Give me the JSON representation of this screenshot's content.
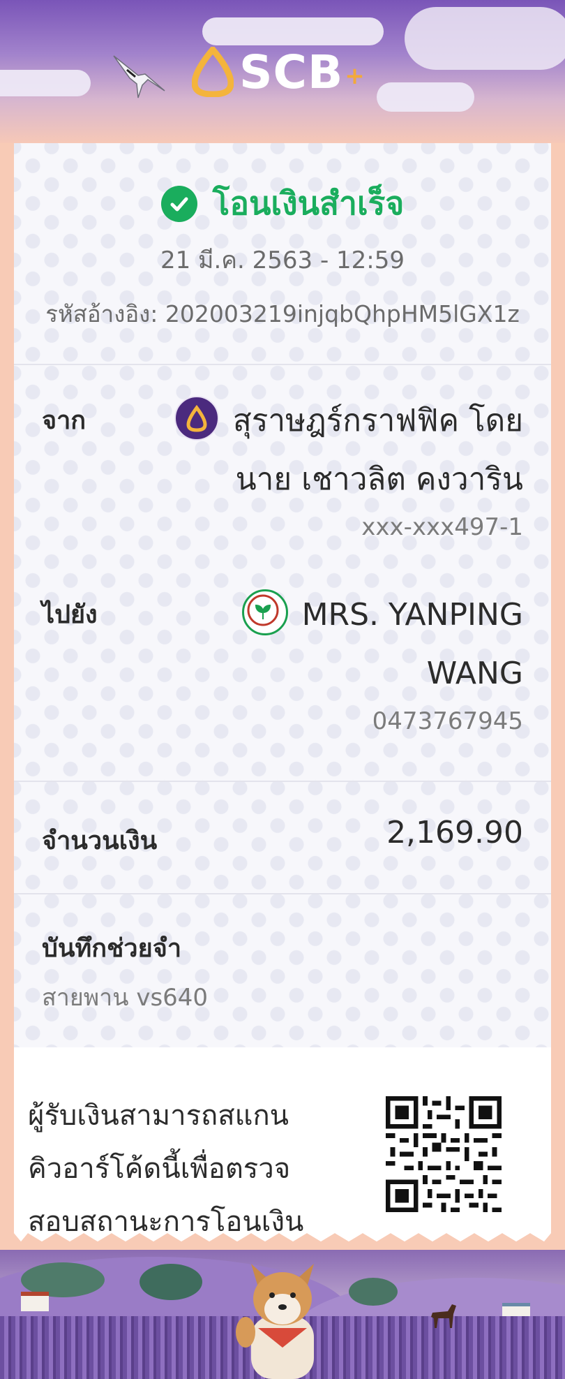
{
  "brand": {
    "name": "SCB",
    "plus": "+"
  },
  "colors": {
    "success": "#1aad5d",
    "brand_purple": "#4b2a7e",
    "brand_gold": "#f2a93b",
    "kbank_green": "#1aa04f"
  },
  "status": {
    "icon": "check-circle-icon",
    "text": "โอนเงินสำเร็จ"
  },
  "transaction": {
    "datetime": "21 มี.ค. 2563 - 12:59",
    "reference_label": "รหัสอ้างอิง:",
    "reference_value": "202003219injqbQhpHM5lGX1z"
  },
  "from": {
    "label": "จาก",
    "bank_icon": "scb-bank-icon",
    "name_line1": "สุราษฎร์กราฟฟิค โดย",
    "name_line2": "นาย เชาวลิต คงวาริน",
    "account": "xxx-xxx497-1"
  },
  "to": {
    "label": "ไปยัง",
    "bank_icon": "kbank-bank-icon",
    "name_line1": "MRS. YANPING",
    "name_line2": "WANG",
    "account": "0473767945"
  },
  "amount": {
    "label": "จำนวนเงิน",
    "value": "2,169.90"
  },
  "memo": {
    "label": "บันทึกช่วยจำ",
    "value": "สายพาน vs640"
  },
  "qr_note": {
    "line1": "ผู้รับเงินสามารถสแกน",
    "line2": "คิวอาร์โค้ดนี้เพื่อตรวจ",
    "line3": "สอบสถานะการโอนเงิน",
    "icon": "qr-code-icon"
  }
}
